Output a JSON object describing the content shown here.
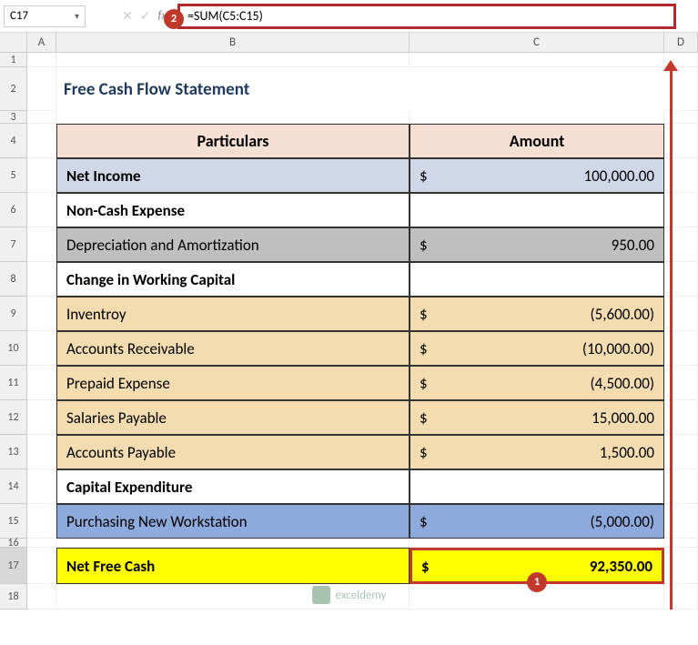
{
  "nameBox": "C17",
  "fxLabel": "fx",
  "formula": "=SUM(C5:C15)",
  "badge1": "1",
  "badge2": "2",
  "colHeaders": {
    "A": "A",
    "B": "B",
    "C": "C",
    "D": "D"
  },
  "rowNums": [
    "1",
    "2",
    "3",
    "4",
    "5",
    "6",
    "7",
    "8",
    "9",
    "10",
    "11",
    "12",
    "13",
    "14",
    "15",
    "16",
    "17",
    "18"
  ],
  "title": "Free Cash Flow Statement",
  "headers": {
    "particulars": "Particulars",
    "amount": "Amount"
  },
  "rows": {
    "r5": {
      "label": "Net Income",
      "cur": "$",
      "val": "100,000.00"
    },
    "r6": {
      "label": "Non-Cash Expense"
    },
    "r7": {
      "label": "Depreciation and Amortization",
      "cur": "$",
      "val": "950.00"
    },
    "r8": {
      "label": "Change in Working Capital"
    },
    "r9": {
      "label": "Inventroy",
      "cur": "$",
      "val": "(5,600.00)"
    },
    "r10": {
      "label": "Accounts Receivable",
      "cur": "$",
      "val": "(10,000.00)"
    },
    "r11": {
      "label": "Prepaid Expense",
      "cur": "$",
      "val": "(4,500.00)"
    },
    "r12": {
      "label": "Salaries Payable",
      "cur": "$",
      "val": "15,000.00"
    },
    "r13": {
      "label": "Accounts Payable",
      "cur": "$",
      "val": "1,500.00"
    },
    "r14": {
      "label": "Capital Expenditure"
    },
    "r15": {
      "label": "Purchasing New Workstation",
      "cur": "$",
      "val": "(5,000.00)"
    },
    "r17": {
      "label": "Net Free Cash",
      "cur": "$",
      "val": "92,350.00"
    }
  },
  "watermark": "exceldemy"
}
